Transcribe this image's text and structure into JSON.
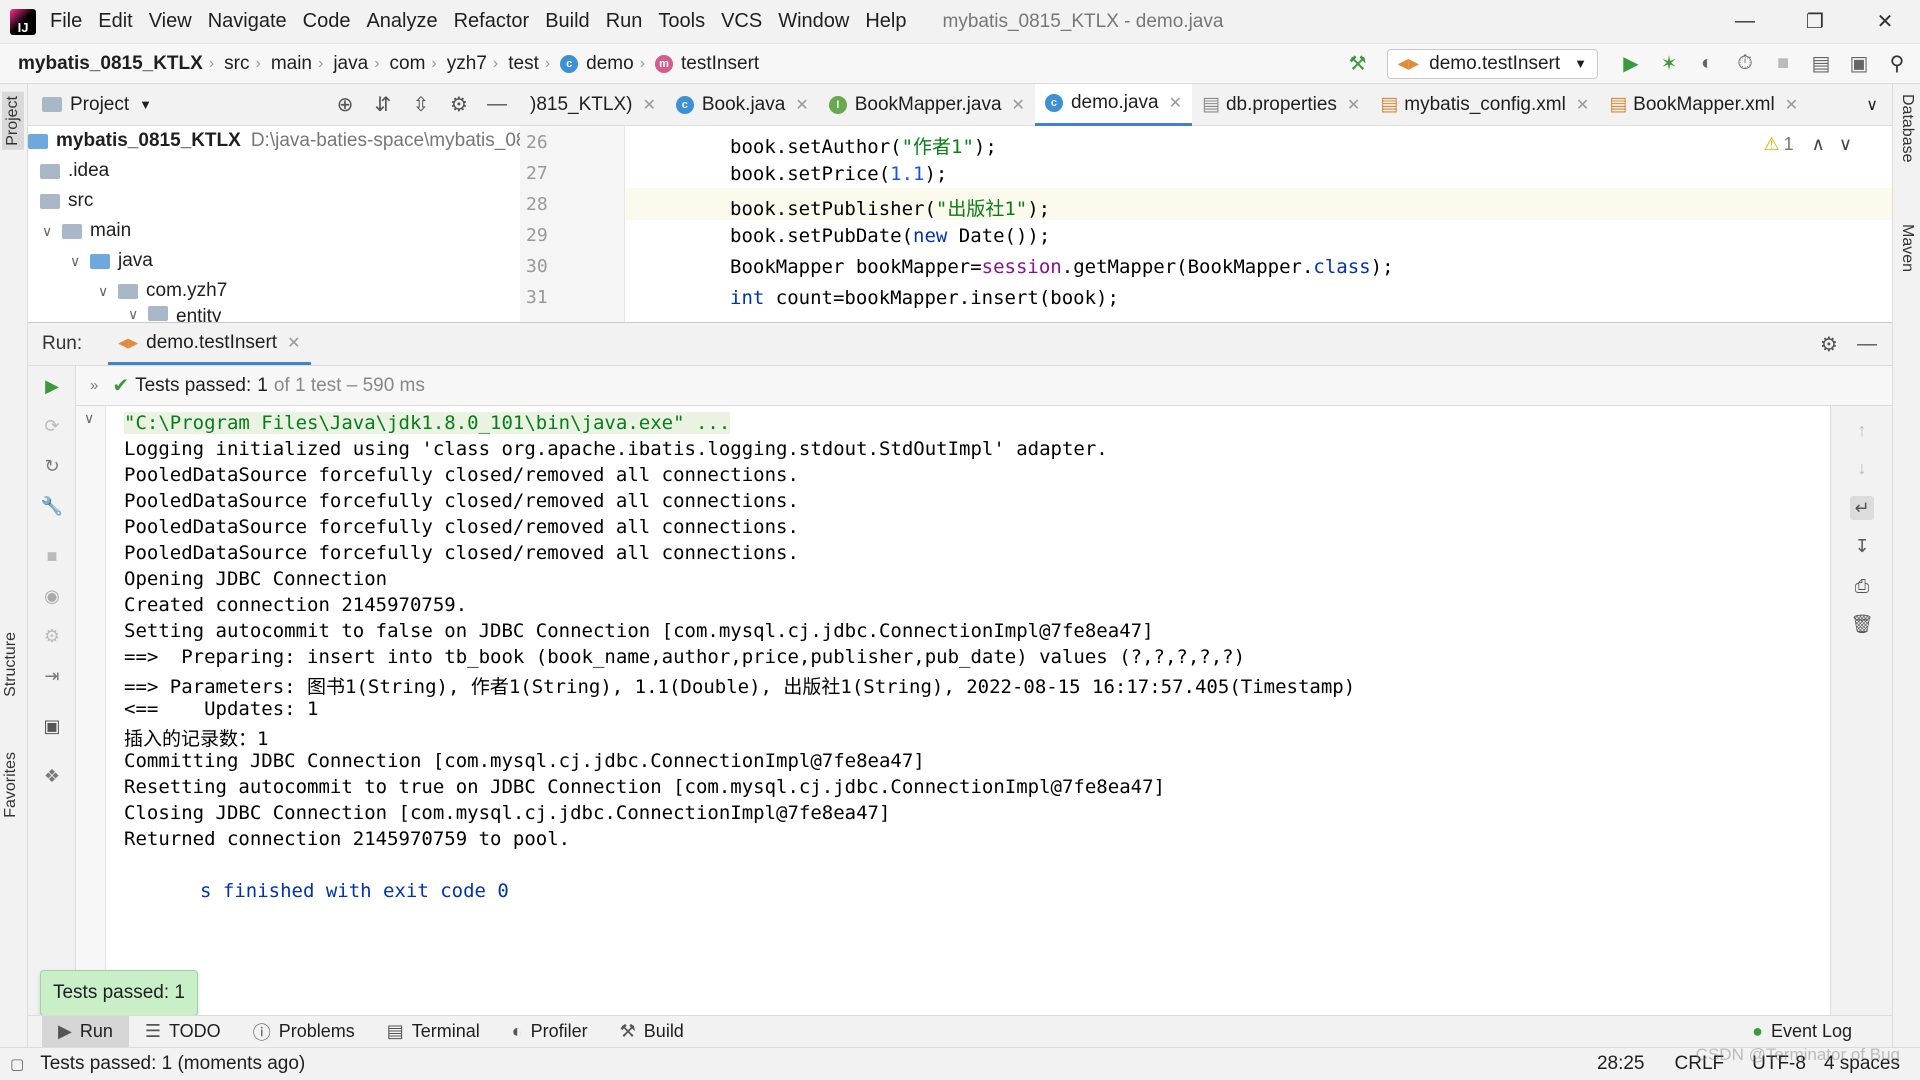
{
  "window": {
    "title": "mybatis_0815_KTLX - demo.java",
    "menu": [
      "File",
      "Edit",
      "View",
      "Navigate",
      "Code",
      "Analyze",
      "Refactor",
      "Build",
      "Run",
      "Tools",
      "VCS",
      "Window",
      "Help"
    ]
  },
  "breadcrumb": [
    "mybatis_0815_KTLX",
    "src",
    "main",
    "java",
    "com",
    "yzh7",
    "test",
    "demo",
    "testInsert"
  ],
  "toolbar": {
    "run_config": "demo.testInsert"
  },
  "left_stripe": {
    "project": "Project",
    "structure": "Structure",
    "favorites": "Favorites"
  },
  "right_stripe": {
    "database": "Database",
    "maven": "Maven"
  },
  "project_panel": {
    "title": "Project",
    "tree": [
      {
        "label": "mybatis_0815_KTLX",
        "path": "D:\\java-baties-space\\mybatis_08"
      },
      {
        "label": ".idea"
      },
      {
        "label": "src"
      },
      {
        "label": "main"
      },
      {
        "label": "java"
      },
      {
        "label": "com.yzh7"
      },
      {
        "label": "entity"
      }
    ]
  },
  "editor_tabs": [
    {
      "label": ")815_KTLX)",
      "active": false
    },
    {
      "label": "Book.java",
      "active": false
    },
    {
      "label": "BookMapper.java",
      "active": false
    },
    {
      "label": "demo.java",
      "active": true
    },
    {
      "label": "db.properties",
      "active": false
    },
    {
      "label": "mybatis_config.xml",
      "active": false
    },
    {
      "label": "BookMapper.xml",
      "active": false
    }
  ],
  "editor": {
    "warning_count": "1",
    "line_numbers": [
      "26",
      "27",
      "28",
      "29",
      "30",
      "31"
    ],
    "lines": [
      {
        "a": "book.setAuthor(",
        "s": "\"作者1\"",
        "b": ");"
      },
      {
        "a": "book.setPrice(",
        "n": "1.1",
        "b": ");"
      },
      {
        "a": "book.setPublisher(",
        "s": "\"出版社1\"",
        "b": ");"
      },
      {
        "a": "book.setPubDate(",
        "k": "new",
        "b": " Date());"
      },
      {
        "a": "BookMapper bookMapper=",
        "f": "session",
        "b": ".getMapper(BookMapper.",
        "k2": "class",
        "c": ");"
      },
      {
        "k": "int",
        "a": " count=bookMapper.insert(book);"
      }
    ]
  },
  "run_panel": {
    "label": "Run:",
    "tab": "demo.testInsert",
    "status_prefix": "Tests passed:",
    "status_count": "1",
    "status_suffix": "of 1 test – 590 ms",
    "console": [
      "\"C:\\Program Files\\Java\\jdk1.8.0_101\\bin\\java.exe\" ...",
      "Logging initialized using 'class org.apache.ibatis.logging.stdout.StdOutImpl' adapter.",
      "PooledDataSource forcefully closed/removed all connections.",
      "PooledDataSource forcefully closed/removed all connections.",
      "PooledDataSource forcefully closed/removed all connections.",
      "PooledDataSource forcefully closed/removed all connections.",
      "Opening JDBC Connection",
      "Created connection 2145970759.",
      "Setting autocommit to false on JDBC Connection [com.mysql.cj.jdbc.ConnectionImpl@7fe8ea47]",
      "==>  Preparing: insert into tb_book (book_name,author,price,publisher,pub_date) values (?,?,?,?,?)",
      "==> Parameters: 图书1(String), 作者1(String), 1.1(Double), 出版社1(String), 2022-08-15 16:17:57.405(Timestamp)",
      "<==    Updates: 1",
      "插入的记录数：1",
      "Committing JDBC Connection [com.mysql.cj.jdbc.ConnectionImpl@7fe8ea47]",
      "Resetting autocommit to true on JDBC Connection [com.mysql.cj.jdbc.ConnectionImpl@7fe8ea47]",
      "Closing JDBC Connection [com.mysql.cj.jdbc.ConnectionImpl@7fe8ea47]",
      "Returned connection 2145970759 to pool."
    ],
    "exit_line": "s finished with exit code 0",
    "toast": "Tests passed: 1"
  },
  "bottom_tabs": [
    "Run",
    "TODO",
    "Problems",
    "Terminal",
    "Profiler",
    "Build"
  ],
  "event_log": "Event Log",
  "statusbar": {
    "message": "Tests passed: 1 (moments ago)",
    "position": "28:25",
    "line_sep": "CRLF",
    "encoding": "UTF-8",
    "indent": "4 spaces",
    "watermark": "CSDN @Terminator of Bug"
  },
  "colors": {
    "accent": "#4083c9",
    "run_green": "#3c9a3c",
    "string": "#067d17",
    "keyword": "#0033b3"
  }
}
